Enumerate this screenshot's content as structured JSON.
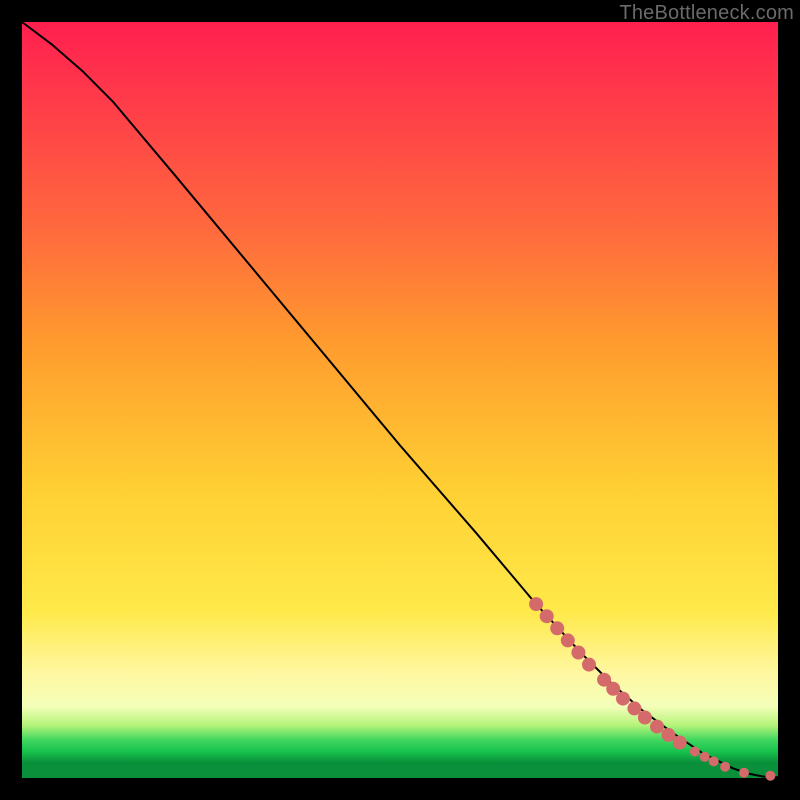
{
  "watermark": "TheBottleneck.com",
  "chart_data": {
    "type": "line",
    "title": "",
    "xlabel": "",
    "ylabel": "",
    "xlim": [
      0,
      100
    ],
    "ylim": [
      0,
      100
    ],
    "grid": false,
    "series": [
      {
        "name": "curve",
        "x": [
          0,
          4,
          8,
          12,
          20,
          30,
          40,
          50,
          60,
          68,
          74,
          78,
          82,
          86,
          90,
          92,
          94,
          96,
          98,
          100
        ],
        "y": [
          100,
          97,
          93.5,
          89.5,
          80,
          68,
          56,
          44,
          32.5,
          23,
          16.5,
          12.5,
          9,
          6,
          3.3,
          2.3,
          1.3,
          0.6,
          0.2,
          0.1
        ],
        "stroke": "#000000",
        "stroke_width": 2
      }
    ],
    "markers": {
      "name": "dots",
      "color": "#d46a6a",
      "radius_small": 5,
      "radius_large": 7,
      "points": [
        {
          "x": 68.0,
          "y": 23.0,
          "r": "large"
        },
        {
          "x": 69.4,
          "y": 21.4,
          "r": "large"
        },
        {
          "x": 70.8,
          "y": 19.8,
          "r": "large"
        },
        {
          "x": 72.2,
          "y": 18.2,
          "r": "large"
        },
        {
          "x": 73.6,
          "y": 16.6,
          "r": "large"
        },
        {
          "x": 75.0,
          "y": 15.0,
          "r": "large"
        },
        {
          "x": 77.0,
          "y": 13.0,
          "r": "large"
        },
        {
          "x": 78.2,
          "y": 11.8,
          "r": "large"
        },
        {
          "x": 79.5,
          "y": 10.5,
          "r": "large"
        },
        {
          "x": 81.0,
          "y": 9.2,
          "r": "large"
        },
        {
          "x": 82.4,
          "y": 8.0,
          "r": "large"
        },
        {
          "x": 84.0,
          "y": 6.8,
          "r": "large"
        },
        {
          "x": 85.5,
          "y": 5.7,
          "r": "large"
        },
        {
          "x": 87.0,
          "y": 4.7,
          "r": "large"
        },
        {
          "x": 89.0,
          "y": 3.5,
          "r": "small"
        },
        {
          "x": 90.3,
          "y": 2.8,
          "r": "small"
        },
        {
          "x": 91.5,
          "y": 2.2,
          "r": "small"
        },
        {
          "x": 93.0,
          "y": 1.5,
          "r": "small"
        },
        {
          "x": 95.5,
          "y": 0.7,
          "r": "small"
        },
        {
          "x": 99.0,
          "y": 0.3,
          "r": "small"
        }
      ]
    }
  }
}
